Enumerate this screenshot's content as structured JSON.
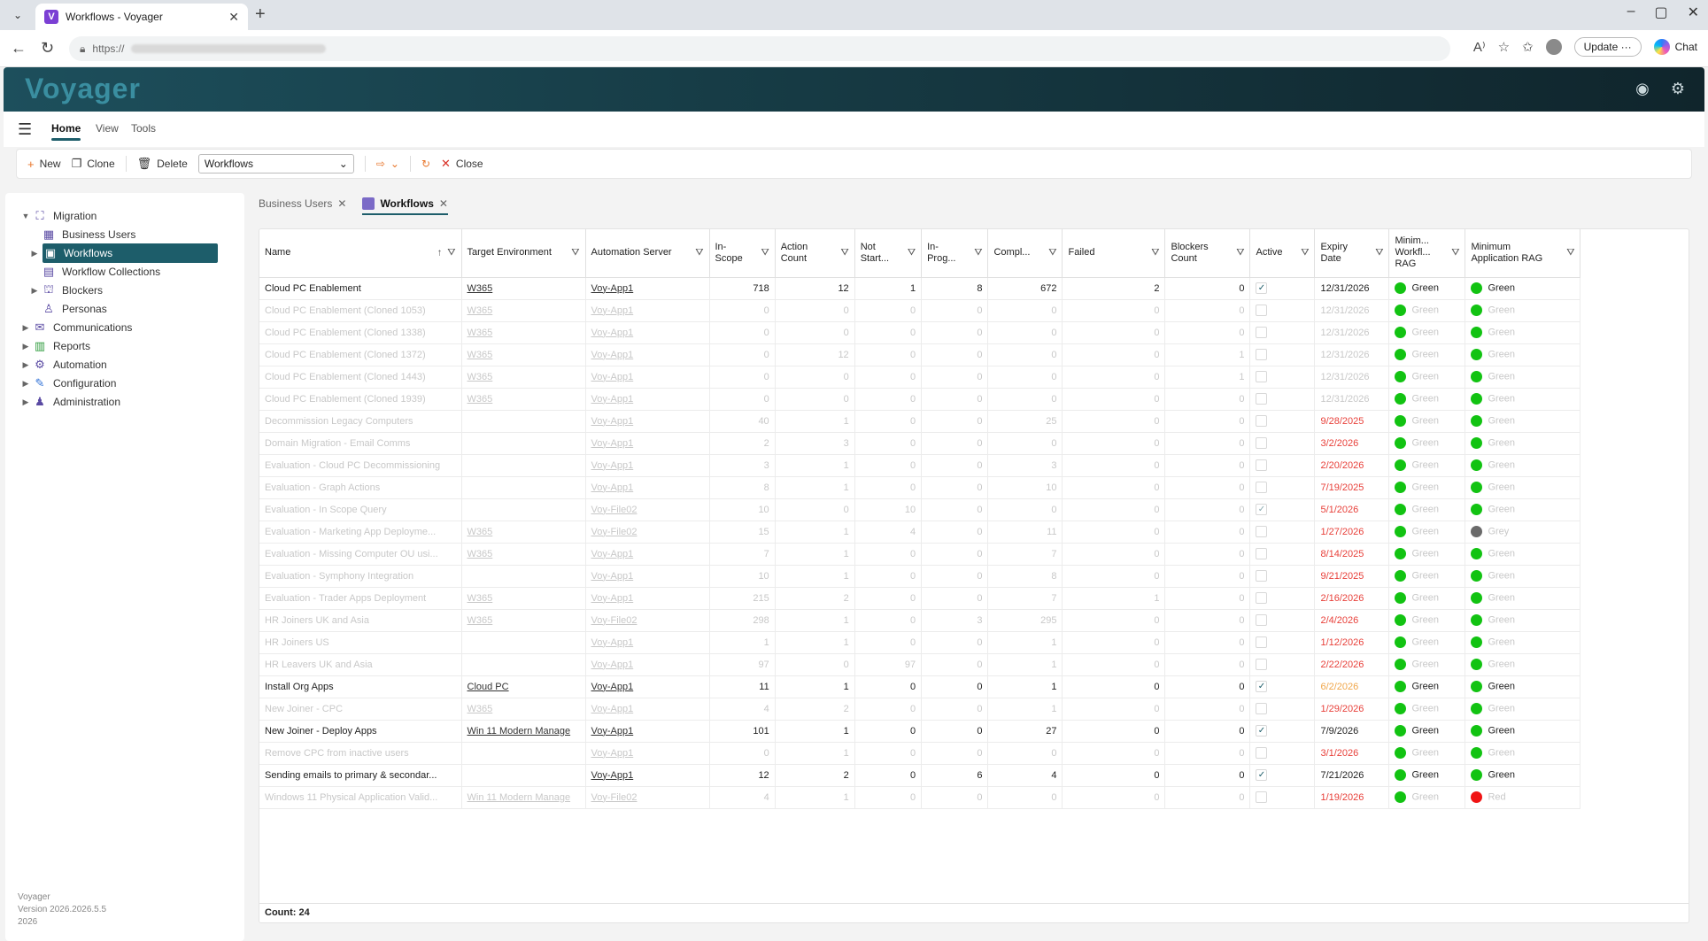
{
  "browser": {
    "tab_title": "Workflows - Voyager",
    "favicon_letter": "V",
    "url_prefix": "https://",
    "update_label": "Update",
    "chat_label": "Chat"
  },
  "app": {
    "brand": "Voyager",
    "menu": [
      "Home",
      "View",
      "Tools"
    ],
    "toolbar": {
      "new": "New",
      "clone": "Clone",
      "delete": "Delete",
      "selector_value": "Workflows",
      "close": "Close"
    },
    "nav": [
      {
        "label": "Migration",
        "level": 0,
        "expanded": true,
        "icon": "migration-icon"
      },
      {
        "label": "Business Users",
        "level": 1,
        "icon": "users-icon"
      },
      {
        "label": "Workflows",
        "level": 1,
        "selected": true,
        "icon": "workflow-icon"
      },
      {
        "label": "Workflow Collections",
        "level": 1,
        "icon": "collection-icon"
      },
      {
        "label": "Blockers",
        "level": 1,
        "icon": "blocker-icon"
      },
      {
        "label": "Personas",
        "level": 1,
        "icon": "persona-icon"
      },
      {
        "label": "Communications",
        "level": 0,
        "icon": "communications-icon"
      },
      {
        "label": "Reports",
        "level": 0,
        "icon": "reports-icon"
      },
      {
        "label": "Automation",
        "level": 0,
        "icon": "automation-icon"
      },
      {
        "label": "Configuration",
        "level": 0,
        "icon": "configuration-icon"
      },
      {
        "label": "Administration",
        "level": 0,
        "icon": "administration-icon"
      }
    ],
    "version": [
      "Voyager",
      "Version 2026.2026.5.5",
      "2026"
    ],
    "doc_tabs": [
      {
        "label": "Business Users",
        "active": false
      },
      {
        "label": "Workflows",
        "active": true
      }
    ]
  },
  "grid": {
    "columns": [
      {
        "label": "Name",
        "sort": true
      },
      {
        "label": "Target Environment"
      },
      {
        "label": "Automation Server"
      },
      {
        "label": "In-Scope"
      },
      {
        "label": "Action Count"
      },
      {
        "label": "Not Start..."
      },
      {
        "label": "In-Prog..."
      },
      {
        "label": "Compl..."
      },
      {
        "label": "Failed"
      },
      {
        "label": "Blockers Count"
      },
      {
        "label": "Active"
      },
      {
        "label": "Expiry Date"
      },
      {
        "label": "Minim... Workfl... RAG"
      },
      {
        "label": "Minimum Application RAG"
      }
    ],
    "rows": [
      {
        "name": "Cloud PC Enablement",
        "env": "W365",
        "server": "Voy-App1",
        "in_scope": "718",
        "action": "12",
        "not_started": "1",
        "in_prog": "8",
        "compl": "672",
        "failed": "2",
        "blockers": "0",
        "active": true,
        "expiry": "12/31/2026",
        "expiry_color": "normal",
        "wf_rag": "Green",
        "wf_rag_color": "green",
        "app_rag": "Green",
        "app_rag_color": "green",
        "dim": false
      },
      {
        "name": "Cloud PC Enablement (Cloned 1053)",
        "env": "W365",
        "server": "Voy-App1",
        "in_scope": "0",
        "action": "0",
        "not_started": "0",
        "in_prog": "0",
        "compl": "0",
        "failed": "0",
        "blockers": "0",
        "active": false,
        "expiry": "12/31/2026",
        "expiry_color": "normal",
        "wf_rag": "Green",
        "wf_rag_color": "green",
        "app_rag": "Green",
        "app_rag_color": "green",
        "dim": true
      },
      {
        "name": "Cloud PC Enablement (Cloned 1338)",
        "env": "W365",
        "server": "Voy-App1",
        "in_scope": "0",
        "action": "0",
        "not_started": "0",
        "in_prog": "0",
        "compl": "0",
        "failed": "0",
        "blockers": "0",
        "active": false,
        "expiry": "12/31/2026",
        "expiry_color": "normal",
        "wf_rag": "Green",
        "wf_rag_color": "green",
        "app_rag": "Green",
        "app_rag_color": "green",
        "dim": true
      },
      {
        "name": "Cloud PC Enablement (Cloned 1372)",
        "env": "W365",
        "server": "Voy-App1",
        "in_scope": "0",
        "action": "12",
        "not_started": "0",
        "in_prog": "0",
        "compl": "0",
        "failed": "0",
        "blockers": "1",
        "active": false,
        "expiry": "12/31/2026",
        "expiry_color": "normal",
        "wf_rag": "Green",
        "wf_rag_color": "green",
        "app_rag": "Green",
        "app_rag_color": "green",
        "dim": true
      },
      {
        "name": "Cloud PC Enablement (Cloned 1443)",
        "env": "W365",
        "server": "Voy-App1",
        "in_scope": "0",
        "action": "0",
        "not_started": "0",
        "in_prog": "0",
        "compl": "0",
        "failed": "0",
        "blockers": "1",
        "active": false,
        "expiry": "12/31/2026",
        "expiry_color": "normal",
        "wf_rag": "Green",
        "wf_rag_color": "green",
        "app_rag": "Green",
        "app_rag_color": "green",
        "dim": true
      },
      {
        "name": "Cloud PC Enablement (Cloned 1939)",
        "env": "W365",
        "server": "Voy-App1",
        "in_scope": "0",
        "action": "0",
        "not_started": "0",
        "in_prog": "0",
        "compl": "0",
        "failed": "0",
        "blockers": "0",
        "active": false,
        "expiry": "12/31/2026",
        "expiry_color": "normal",
        "wf_rag": "Green",
        "wf_rag_color": "green",
        "app_rag": "Green",
        "app_rag_color": "green",
        "dim": true
      },
      {
        "name": "Decommission Legacy Computers",
        "env": "",
        "server": "Voy-App1",
        "in_scope": "40",
        "action": "1",
        "not_started": "0",
        "in_prog": "0",
        "compl": "25",
        "failed": "0",
        "blockers": "0",
        "active": false,
        "expiry": "9/28/2025",
        "expiry_color": "red",
        "wf_rag": "Green",
        "wf_rag_color": "green",
        "app_rag": "Green",
        "app_rag_color": "green",
        "dim": true
      },
      {
        "name": "Domain Migration - Email Comms",
        "env": "",
        "server": "Voy-App1",
        "in_scope": "2",
        "action": "3",
        "not_started": "0",
        "in_prog": "0",
        "compl": "0",
        "failed": "0",
        "blockers": "0",
        "active": false,
        "expiry": "3/2/2026",
        "expiry_color": "red",
        "wf_rag": "Green",
        "wf_rag_color": "green",
        "app_rag": "Green",
        "app_rag_color": "green",
        "dim": true
      },
      {
        "name": "Evaluation - Cloud PC Decommissioning",
        "env": "",
        "server": "Voy-App1",
        "in_scope": "3",
        "action": "1",
        "not_started": "0",
        "in_prog": "0",
        "compl": "3",
        "failed": "0",
        "blockers": "0",
        "active": false,
        "expiry": "2/20/2026",
        "expiry_color": "red",
        "wf_rag": "Green",
        "wf_rag_color": "green",
        "app_rag": "Green",
        "app_rag_color": "green",
        "dim": true
      },
      {
        "name": "Evaluation - Graph Actions",
        "env": "",
        "server": "Voy-App1",
        "in_scope": "8",
        "action": "1",
        "not_started": "0",
        "in_prog": "0",
        "compl": "10",
        "failed": "0",
        "blockers": "0",
        "active": false,
        "expiry": "7/19/2025",
        "expiry_color": "red",
        "wf_rag": "Green",
        "wf_rag_color": "green",
        "app_rag": "Green",
        "app_rag_color": "green",
        "dim": true
      },
      {
        "name": "Evaluation - In Scope Query",
        "env": "",
        "server": "Voy-File02",
        "in_scope": "10",
        "action": "0",
        "not_started": "10",
        "in_prog": "0",
        "compl": "0",
        "failed": "0",
        "blockers": "0",
        "active": true,
        "expiry": "5/1/2026",
        "expiry_color": "red",
        "wf_rag": "Green",
        "wf_rag_color": "green",
        "app_rag": "Green",
        "app_rag_color": "green",
        "dim": true
      },
      {
        "name": "Evaluation - Marketing App Deployme...",
        "env": "W365",
        "server": "Voy-File02",
        "in_scope": "15",
        "action": "1",
        "not_started": "4",
        "in_prog": "0",
        "compl": "11",
        "failed": "0",
        "blockers": "0",
        "active": false,
        "expiry": "1/27/2026",
        "expiry_color": "red",
        "wf_rag": "Green",
        "wf_rag_color": "green",
        "app_rag": "Grey",
        "app_rag_color": "grey",
        "dim": true
      },
      {
        "name": "Evaluation - Missing Computer OU usi...",
        "env": "W365",
        "server": "Voy-App1",
        "in_scope": "7",
        "action": "1",
        "not_started": "0",
        "in_prog": "0",
        "compl": "7",
        "failed": "0",
        "blockers": "0",
        "active": false,
        "expiry": "8/14/2025",
        "expiry_color": "red",
        "wf_rag": "Green",
        "wf_rag_color": "green",
        "app_rag": "Green",
        "app_rag_color": "green",
        "dim": true
      },
      {
        "name": "Evaluation - Symphony Integration",
        "env": "",
        "server": "Voy-App1",
        "in_scope": "10",
        "action": "1",
        "not_started": "0",
        "in_prog": "0",
        "compl": "8",
        "failed": "0",
        "blockers": "0",
        "active": false,
        "expiry": "9/21/2025",
        "expiry_color": "red",
        "wf_rag": "Green",
        "wf_rag_color": "green",
        "app_rag": "Green",
        "app_rag_color": "green",
        "dim": true
      },
      {
        "name": "Evaluation - Trader Apps Deployment",
        "env": "W365",
        "server": "Voy-App1",
        "in_scope": "215",
        "action": "2",
        "not_started": "0",
        "in_prog": "0",
        "compl": "7",
        "failed": "1",
        "blockers": "0",
        "active": false,
        "expiry": "2/16/2026",
        "expiry_color": "red",
        "wf_rag": "Green",
        "wf_rag_color": "green",
        "app_rag": "Green",
        "app_rag_color": "green",
        "dim": true
      },
      {
        "name": "HR Joiners UK and Asia",
        "env": "W365",
        "server": "Voy-File02",
        "in_scope": "298",
        "action": "1",
        "not_started": "0",
        "in_prog": "3",
        "compl": "295",
        "failed": "0",
        "blockers": "0",
        "active": false,
        "expiry": "2/4/2026",
        "expiry_color": "red",
        "wf_rag": "Green",
        "wf_rag_color": "green",
        "app_rag": "Green",
        "app_rag_color": "green",
        "dim": true
      },
      {
        "name": "HR Joiners US",
        "env": "",
        "server": "Voy-App1",
        "in_scope": "1",
        "action": "1",
        "not_started": "0",
        "in_prog": "0",
        "compl": "1",
        "failed": "0",
        "blockers": "0",
        "active": false,
        "expiry": "1/12/2026",
        "expiry_color": "red",
        "wf_rag": "Green",
        "wf_rag_color": "green",
        "app_rag": "Green",
        "app_rag_color": "green",
        "dim": true
      },
      {
        "name": "HR Leavers UK and Asia",
        "env": "",
        "server": "Voy-App1",
        "in_scope": "97",
        "action": "0",
        "not_started": "97",
        "in_prog": "0",
        "compl": "1",
        "failed": "0",
        "blockers": "0",
        "active": false,
        "expiry": "2/22/2026",
        "expiry_color": "red",
        "wf_rag": "Green",
        "wf_rag_color": "green",
        "app_rag": "Green",
        "app_rag_color": "green",
        "dim": true
      },
      {
        "name": "Install Org Apps",
        "env": "Cloud PC",
        "server": "Voy-App1",
        "in_scope": "11",
        "action": "1",
        "not_started": "0",
        "in_prog": "0",
        "compl": "1",
        "failed": "0",
        "blockers": "0",
        "active": true,
        "expiry": "6/2/2026",
        "expiry_color": "orange",
        "wf_rag": "Green",
        "wf_rag_color": "green",
        "app_rag": "Green",
        "app_rag_color": "green",
        "dim": false
      },
      {
        "name": "New Joiner - CPC",
        "env": "W365",
        "server": "Voy-App1",
        "in_scope": "4",
        "action": "2",
        "not_started": "0",
        "in_prog": "0",
        "compl": "1",
        "failed": "0",
        "blockers": "0",
        "active": false,
        "expiry": "1/29/2026",
        "expiry_color": "red",
        "wf_rag": "Green",
        "wf_rag_color": "green",
        "app_rag": "Green",
        "app_rag_color": "green",
        "dim": true
      },
      {
        "name": "New Joiner - Deploy Apps",
        "env": "Win 11 Modern Manage",
        "server": "Voy-App1",
        "in_scope": "101",
        "action": "1",
        "not_started": "0",
        "in_prog": "0",
        "compl": "27",
        "failed": "0",
        "blockers": "0",
        "active": true,
        "expiry": "7/9/2026",
        "expiry_color": "normal",
        "wf_rag": "Green",
        "wf_rag_color": "green",
        "app_rag": "Green",
        "app_rag_color": "green",
        "dim": false
      },
      {
        "name": "Remove CPC from inactive users",
        "env": "",
        "server": "Voy-App1",
        "in_scope": "0",
        "action": "1",
        "not_started": "0",
        "in_prog": "0",
        "compl": "0",
        "failed": "0",
        "blockers": "0",
        "active": false,
        "expiry": "3/1/2026",
        "expiry_color": "red",
        "wf_rag": "Green",
        "wf_rag_color": "green",
        "app_rag": "Green",
        "app_rag_color": "green",
        "dim": true
      },
      {
        "name": "Sending emails to primary & secondar...",
        "env": "",
        "server": "Voy-App1",
        "in_scope": "12",
        "action": "2",
        "not_started": "0",
        "in_prog": "6",
        "compl": "4",
        "failed": "0",
        "blockers": "0",
        "active": true,
        "expiry": "7/21/2026",
        "expiry_color": "normal",
        "wf_rag": "Green",
        "wf_rag_color": "green",
        "app_rag": "Green",
        "app_rag_color": "green",
        "dim": false
      },
      {
        "name": "Windows 11 Physical Application Valid...",
        "env": "Win 11 Modern Manage",
        "server": "Voy-File02",
        "in_scope": "4",
        "action": "1",
        "not_started": "0",
        "in_prog": "0",
        "compl": "0",
        "failed": "0",
        "blockers": "0",
        "active": false,
        "expiry": "1/19/2026",
        "expiry_color": "red",
        "wf_rag": "Green",
        "wf_rag_color": "green",
        "app_rag": "Red",
        "app_rag_color": "red",
        "dim": true
      }
    ],
    "footer": "Count: 24"
  }
}
